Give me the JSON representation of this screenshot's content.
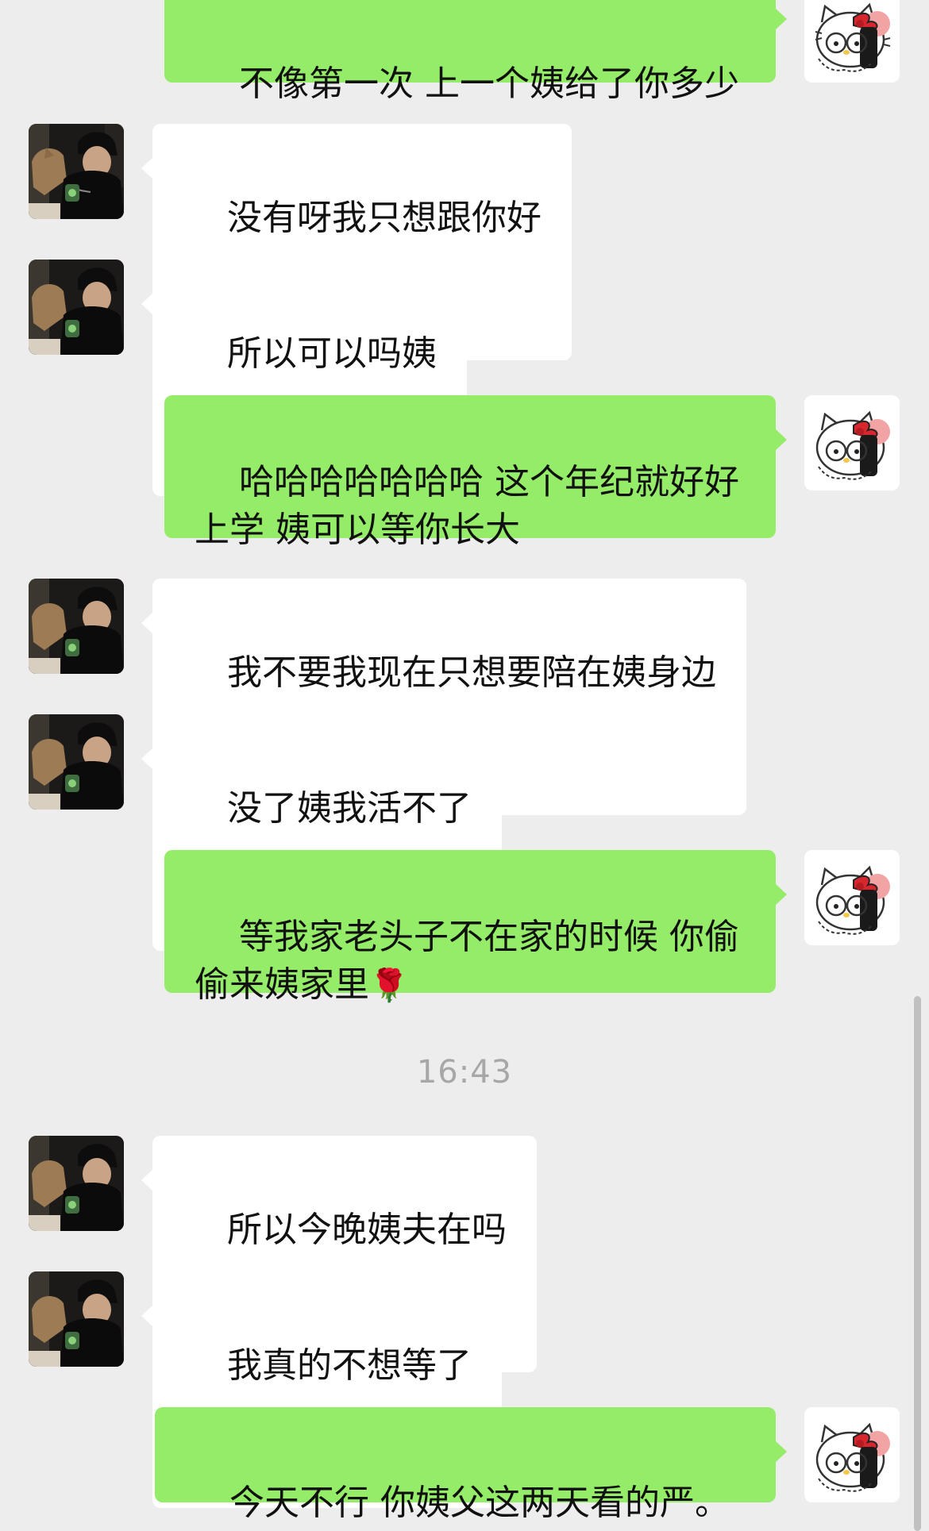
{
  "conversation": {
    "timestamp": "16:43",
    "messages": [
      {
        "side": "out",
        "text": "不像第一次 上一个姨给了你多少"
      },
      {
        "side": "in",
        "text": "没有呀我只想跟你好"
      },
      {
        "side": "in",
        "text": "所以可以吗姨"
      },
      {
        "side": "out",
        "text": "哈哈哈哈哈哈哈 这个年纪就好好\n上学 姨可以等你长大"
      },
      {
        "side": "in",
        "text": "我不要我现在只想要陪在姨身边"
      },
      {
        "side": "in",
        "text": "没了姨我活不了"
      },
      {
        "side": "out",
        "text": "等我家老头子不在家的时候 你偷\n偷来姨家里",
        "emoji": "🌹"
      },
      {
        "side": "in",
        "text": "所以今晚姨夫在吗"
      },
      {
        "side": "in",
        "text": "我真的不想等了"
      },
      {
        "side": "out",
        "text": "今天不行 你姨父这两天看的严。"
      }
    ]
  },
  "colors": {
    "background": "#ededed",
    "outgoing_bubble": "#95ec69",
    "incoming_bubble": "#ffffff",
    "timestamp_text": "#a7a7a7"
  },
  "icons": {
    "contact_avatar": "man-with-cap-and-cat-photo",
    "self_avatar": "hello-kitty-sticker"
  }
}
